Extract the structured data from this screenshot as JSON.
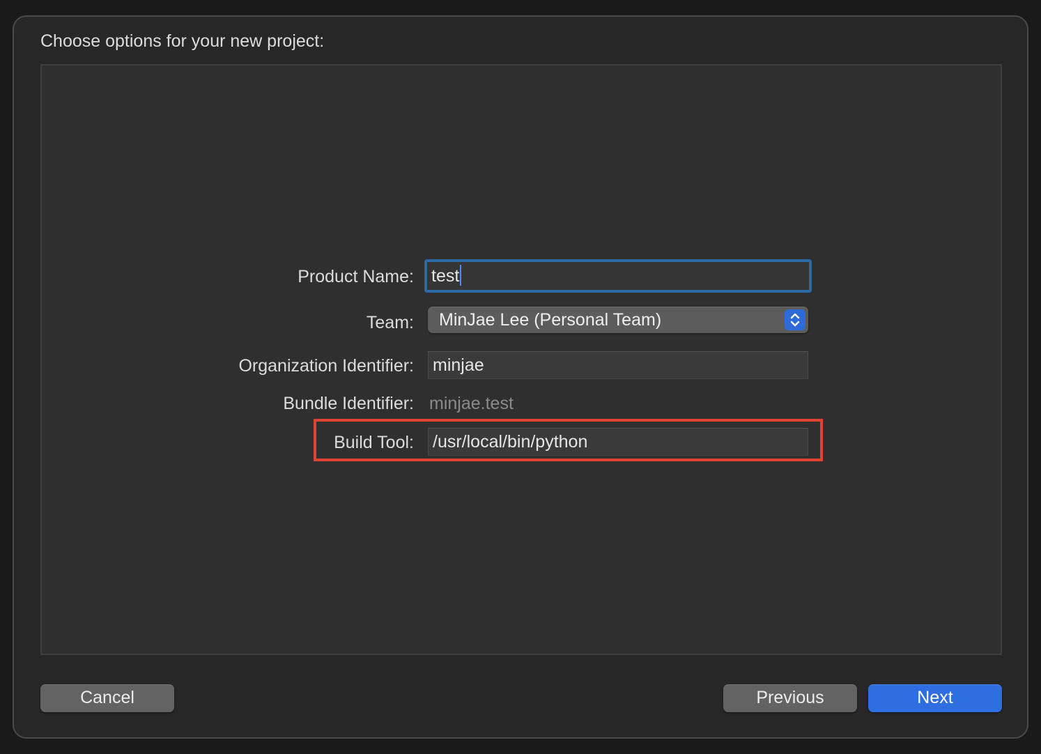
{
  "dialog": {
    "title": "Choose options for your new project:"
  },
  "form": {
    "product_name": {
      "label": "Product Name:",
      "value": "test"
    },
    "team": {
      "label": "Team:",
      "selected": "MinJae Lee (Personal Team)"
    },
    "organization_identifier": {
      "label": "Organization Identifier:",
      "value": "minjae"
    },
    "bundle_identifier": {
      "label": "Bundle Identifier:",
      "value": "minjae.test"
    },
    "build_tool": {
      "label": "Build Tool:",
      "value": "/usr/local/bin/python"
    }
  },
  "buttons": {
    "cancel": "Cancel",
    "previous": "Previous",
    "next": "Next"
  },
  "colors": {
    "accent": "#2f6ee0",
    "focus_ring": "#2f6aa8",
    "highlight_annotation": "#e0432f"
  },
  "icons": {
    "popup_indicator": "chevron-up-down-icon"
  }
}
